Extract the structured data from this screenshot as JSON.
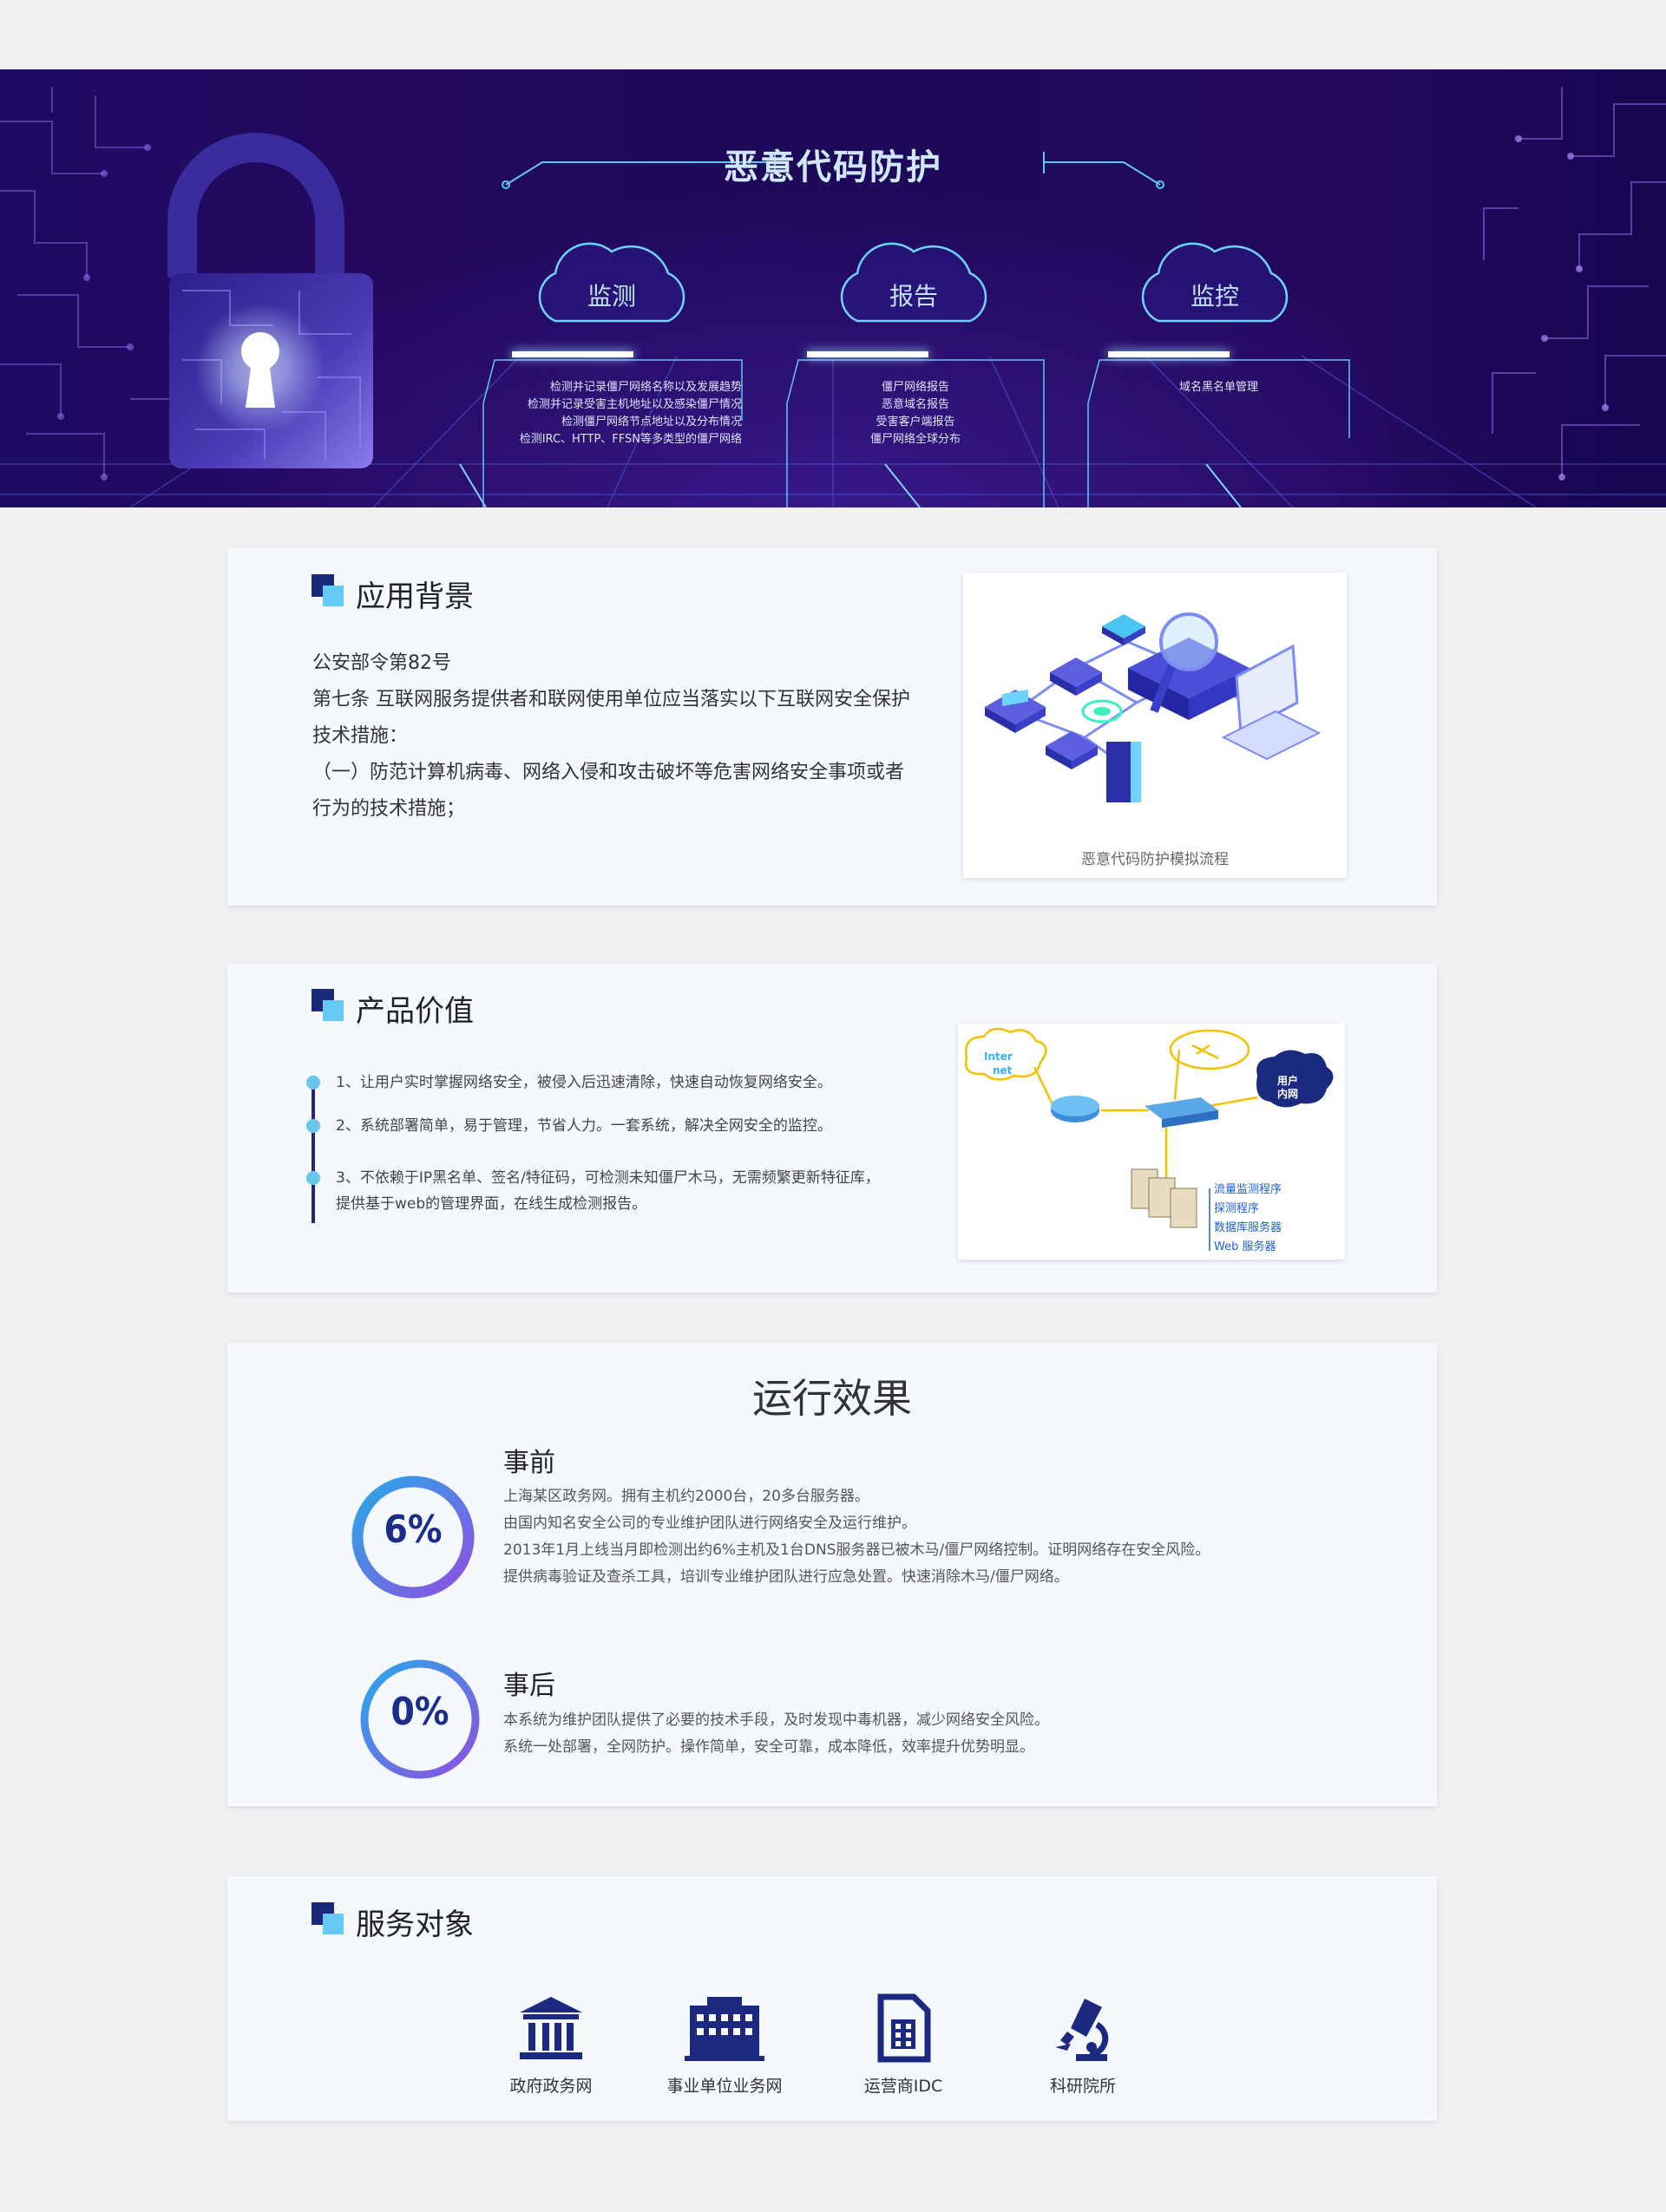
{
  "hero": {
    "title": "恶意代码防护",
    "clouds": [
      {
        "label": "监测",
        "lines": [
          "检测并记录僵尸网络名称以及发展趋势",
          "检测并记录受害主机地址以及感染僵尸情况",
          "检测僵尸网络节点地址以及分布情况",
          "检测IRC、HTTP、FFSN等多类型的僵尸网络"
        ]
      },
      {
        "label": "报告",
        "lines": [
          "僵尸网络报告",
          "恶意域名报告",
          "受害客户端报告",
          "僵尸网络全球分布"
        ]
      },
      {
        "label": "监控",
        "lines": [
          "域名黑名单管理"
        ]
      }
    ],
    "colors": {
      "bg": "#1e0a63",
      "accent": "#6fd3ff"
    }
  },
  "background": {
    "title": "应用背景",
    "paragraphs": [
      "公安部令第82号",
      "第七条  互联网服务提供者和联网使用单位应当落实以下互联网安全保护技术措施：",
      "（一）防范计算机病毒、网络入侵和攻击破坏等危害网络安全事项或者行为的技术措施；"
    ],
    "image_caption": "恶意代码防护模拟流程"
  },
  "value": {
    "title": "产品价值",
    "items": [
      "1、让用户实时掌握网络安全，被侵入后迅速清除，快速自动恢复网络安全。",
      "2、系统部署简单，易于管理，节省人力。一套系统，解决全网安全的监控。",
      "3、不依赖于IP黑名单、签名/特征码，可检测未知僵尸木马，无需频繁更新特征库，"
    ],
    "item3_extra": "提供基于web的管理界面，在线生成检测报告。",
    "diagram": {
      "internet": "Inter\nnet",
      "internet_line1": "Inter",
      "internet_line2": "net",
      "user_net_line1": "用户",
      "user_net_line2": "内网",
      "servers": [
        "流量监测程序",
        "探测程序",
        "数据库服务器",
        "Web 服务器"
      ]
    }
  },
  "effect": {
    "title": "运行效果",
    "before": {
      "percent": "6%",
      "heading": "事前",
      "lines": [
        "上海某区政务网。拥有主机约2000台，20多台服务器。",
        "由国内知名安全公司的专业维护团队进行网络安全及运行维护。",
        "2013年1月上线当月即检测出约6%主机及1台DNS服务器已被木马/僵尸网络控制。证明网络存在安全风险。",
        "提供病毒验证及查杀工具，培训专业维护团队进行应急处置。快速消除木马/僵尸网络。"
      ]
    },
    "after": {
      "percent": "0%",
      "heading": "事后",
      "lines": [
        "本系统为维护团队提供了必要的技术手段，及时发现中毒机器，减少网络安全风险。",
        "系统一处部署，全网防护。操作简单，安全可靠，成本降低，效率提升优势明显。"
      ]
    }
  },
  "service": {
    "title": "服务对象",
    "items": [
      {
        "label": "政府政务网",
        "icon": "government-building-icon"
      },
      {
        "label": "事业单位业务网",
        "icon": "office-building-icon"
      },
      {
        "label": "运营商IDC",
        "icon": "sim-card-icon"
      },
      {
        "label": "科研院所",
        "icon": "microscope-icon"
      }
    ],
    "icon_color": "#1b2a80"
  }
}
